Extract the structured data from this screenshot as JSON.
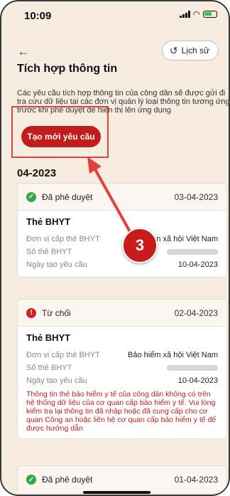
{
  "status_bar": {
    "time": "10:09"
  },
  "header": {
    "back_icon": "back-arrow-icon",
    "history_label": "Lịch sử",
    "title": "Tích hợp thông tin",
    "description": "Các yêu cầu tích hợp thông tin của công dân sẽ được gửi đi tra cứu dữ liệu tại các đơn vị quản lý loại thông tin tương ứng trước khi phê duyệt để hiển thị lên ứng dụng",
    "new_request_label": "Tạo mới yêu cầu"
  },
  "annotation": {
    "step_number": "3"
  },
  "month_label": "04-2023",
  "cards": [
    {
      "status": "Đã phê duyệt",
      "date": "03-04-2023",
      "title": "Thẻ BHYT",
      "rows": [
        {
          "label": "Đơn vị cấp thẻ BHYT",
          "value": "n xã hội Việt Nam"
        },
        {
          "label": "Số thẻ BHYT",
          "value": ""
        },
        {
          "label": "Ngày tạo yêu cầu",
          "value": "10-04-2023"
        }
      ]
    },
    {
      "status": "Từ chối",
      "date": "02-04-2023",
      "title": "Thẻ BHYT",
      "rows": [
        {
          "label": "Đơn vị cấp thẻ BHYT",
          "value": "Bảo hiểm xã hội Việt Nam"
        },
        {
          "label": "Số thẻ BHYT",
          "value": ""
        },
        {
          "label": "Ngày tạo yêu cầu",
          "value": "10-04-2023"
        }
      ],
      "note": "Thông tin thẻ bảo hiểm y tế của công dân không có trên hệ thống dữ liệu của cơ quan cấp bảo hiểm y tế. Vui lòng kiểm tra lại thông tin đã nhập hoặc đã cung cấp cho cơ quan Công an hoặc liên hệ cơ quan cấp bảo hiểm y tế để được hướng dẫn"
    },
    {
      "status": "Đã phê duyệt",
      "date": "01-04-2023"
    }
  ],
  "colors": {
    "accent": "#c21c1c",
    "approved": "#31a84a",
    "highlight": "#e2423d"
  }
}
